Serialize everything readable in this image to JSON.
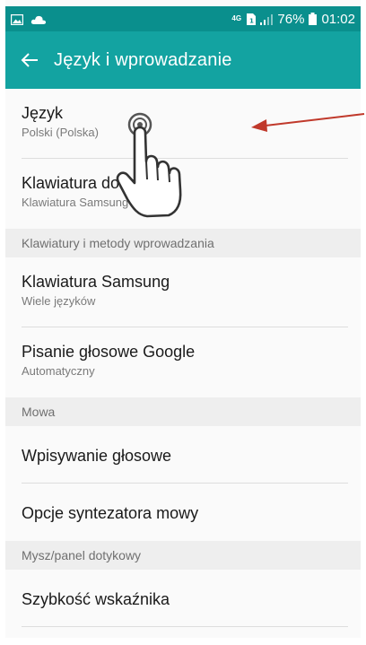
{
  "status_bar": {
    "network": "4G",
    "battery": "76%",
    "time": "01:02"
  },
  "app_bar": {
    "title": "Język i wprowadzanie"
  },
  "items": [
    {
      "title": "Język",
      "subtitle": "Polski (Polska)"
    },
    {
      "title": "Klawiatura domyślna",
      "subtitle": "Klawiatura Samsung"
    }
  ],
  "sections": [
    {
      "header": "Klawiatury i metody wprowadzania",
      "items": [
        {
          "title": "Klawiatura Samsung",
          "subtitle": "Wiele języków"
        },
        {
          "title": "Pisanie głosowe Google",
          "subtitle": "Automatyczny"
        }
      ]
    },
    {
      "header": "Mowa",
      "items": [
        {
          "title": "Wpisywanie głosowe"
        },
        {
          "title": "Opcje syntezatora mowy"
        }
      ]
    },
    {
      "header": "Mysz/panel dotykowy",
      "items": [
        {
          "title": "Szybkość wskaźnika"
        }
      ]
    }
  ],
  "colors": {
    "status_bar": "#0a8f8d",
    "app_bar": "#13a3a1",
    "annotation_arrow": "#c0392b"
  },
  "icons": [
    "gallery-icon",
    "cloud-icon",
    "sim-icon",
    "signal-icon",
    "battery-icon",
    "back-arrow-icon",
    "tap-hand-icon"
  ]
}
